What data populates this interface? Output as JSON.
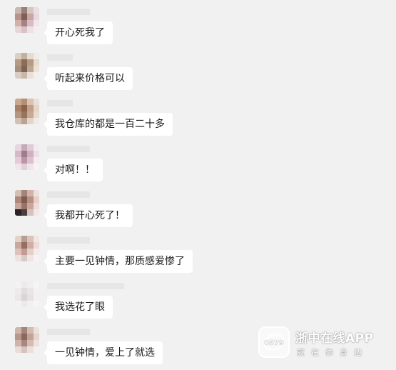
{
  "messages": [
    {
      "text": "开心死我了"
    },
    {
      "text": "听起来价格可以"
    },
    {
      "text": "我仓库的都是一百二十多"
    },
    {
      "text": "对啊！！"
    },
    {
      "text": "我都开心死了！"
    },
    {
      "text": "主要一见钟情，那质感爱惨了"
    },
    {
      "text": "我选花了眼"
    },
    {
      "text": "一见钟情，爱上了就选"
    }
  ],
  "watermark": {
    "title": "浙中在线APP",
    "slogan": "就在你身边",
    "logo_text": "0579"
  },
  "colors": {
    "background": "#f1f1f1",
    "bubble": "#ffffff",
    "text": "#1a1a1a"
  }
}
